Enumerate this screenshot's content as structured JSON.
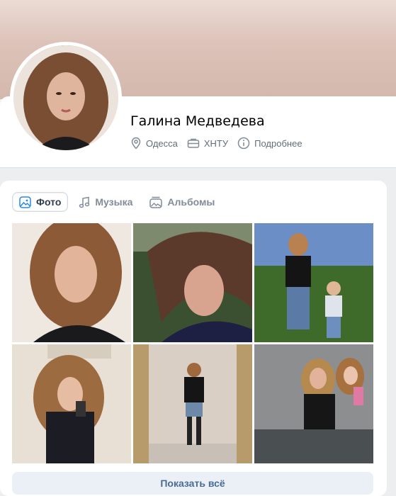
{
  "profile": {
    "name": "Галина Медведева",
    "city": "Одесса",
    "university": "ХНТУ",
    "details_link": "Подробнее"
  },
  "gallery": {
    "tabs": [
      {
        "label": "Фото",
        "icon": "photo-icon",
        "active": true
      },
      {
        "label": "Музыка",
        "icon": "music-note-icon",
        "active": false
      },
      {
        "label": "Альбомы",
        "icon": "album-icon",
        "active": false
      }
    ],
    "show_all_label": "Показать всё"
  },
  "colors": {
    "accent": "#4a6b94",
    "text_secondary": "#626d7a",
    "background": "#edeef0"
  }
}
